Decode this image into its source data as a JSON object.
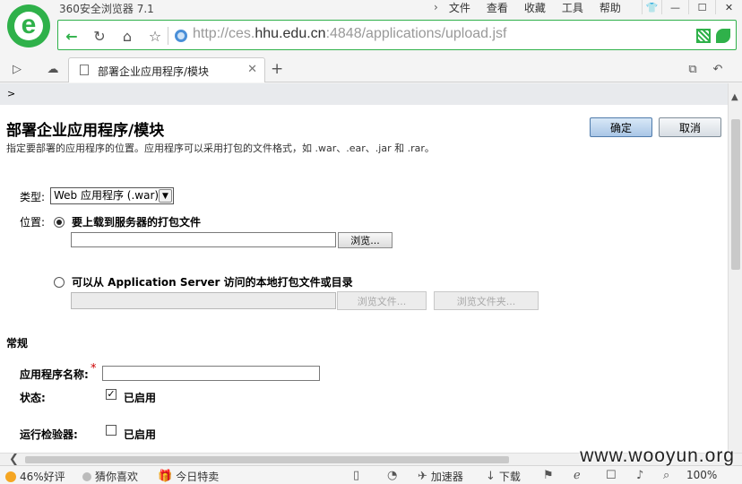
{
  "browser": {
    "title": "360安全浏览器 7.1",
    "menu": [
      "文件",
      "查看",
      "收藏",
      "工具",
      "帮助"
    ],
    "url_prefix": "http://ces.",
    "url_domain": "hhu.edu.cn",
    "url_suffix": ":4848/applications/upload.jsf",
    "tab_label": "部署企业应用程序/模块"
  },
  "page": {
    "breadcrumb": ">",
    "title": "部署企业应用程序/模块",
    "description": "指定要部署的应用程序的位置。应用程序可以采用打包的文件格式，如 .war、.ear、.jar 和 .rar。",
    "ok_label": "确定",
    "cancel_label": "取消",
    "type_label": "类型:",
    "type_value": "Web 应用程序 (.war)",
    "location_label": "位置:",
    "upload_option": "要上载到服务器的打包文件",
    "browse_label": "浏览...",
    "local_option": "可以从 Application Server 访问的本地打包文件或目录",
    "browse_files_label": "浏览文件...",
    "browse_folder_label": "浏览文件夹...",
    "general_heading": "常规",
    "app_name_label": "应用程序名称:",
    "required_mark": "*",
    "status_label": "状态:",
    "status_enabled": "已启用",
    "verifier_label": "运行检验器:",
    "verifier_enabled": "已启用"
  },
  "statusbar": {
    "rating": "46%好评",
    "guess": "猜你喜欢",
    "today": "今日特卖",
    "accelerator": "加速器",
    "download": "下载",
    "zoom": "100%"
  },
  "watermark": "www.wooyun.org"
}
